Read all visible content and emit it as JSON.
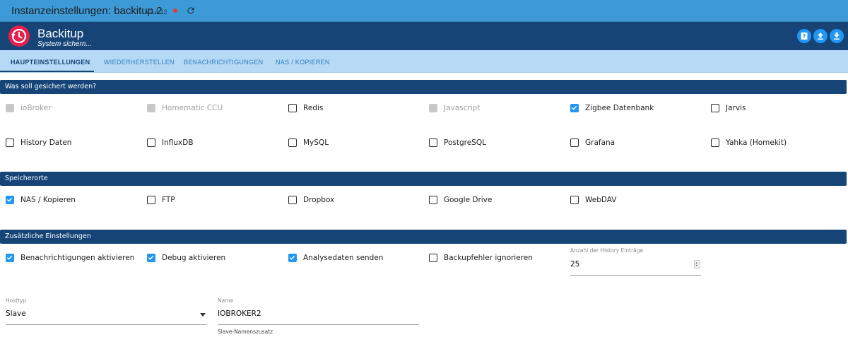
{
  "window": {
    "title": "Instanzeinstellungen: backitup.2",
    "version": "v2.4.12"
  },
  "app": {
    "name": "Backitup",
    "subtitle": "System sichern..."
  },
  "tabs": [
    {
      "label": "HAUPTEINSTELLUNGEN",
      "active": true
    },
    {
      "label": "WIEDERHERSTELLEN",
      "active": false
    },
    {
      "label": "BENACHRICHTIGUNGEN",
      "active": false
    },
    {
      "label": "NAS / KOPIEREN",
      "active": false
    }
  ],
  "sections": {
    "backup_what": "Was soll gesichert werden?",
    "storage": "Speicherorte",
    "extra": "Zusätzliche Einstellungen"
  },
  "backup_options": [
    {
      "label": "ioBroker",
      "checked": true,
      "disabled": true
    },
    {
      "label": "Homematic CCU",
      "checked": false,
      "disabled": true
    },
    {
      "label": "Redis",
      "checked": false,
      "disabled": false
    },
    {
      "label": "Javascript",
      "checked": false,
      "disabled": true
    },
    {
      "label": "Zigbee Datenbank",
      "checked": true,
      "disabled": false
    },
    {
      "label": "Jarvis",
      "checked": false,
      "disabled": false
    },
    {
      "label": "History Daten",
      "checked": false,
      "disabled": false
    },
    {
      "label": "InfluxDB",
      "checked": false,
      "disabled": false
    },
    {
      "label": "MySQL",
      "checked": false,
      "disabled": false
    },
    {
      "label": "PostgreSQL",
      "checked": false,
      "disabled": false
    },
    {
      "label": "Grafana",
      "checked": false,
      "disabled": false
    },
    {
      "label": "Yahka (Homekit)",
      "checked": false,
      "disabled": false
    }
  ],
  "storage_options": [
    {
      "label": "NAS / Kopieren",
      "checked": true
    },
    {
      "label": "FTP",
      "checked": false
    },
    {
      "label": "Dropbox",
      "checked": false
    },
    {
      "label": "Google Drive",
      "checked": false
    },
    {
      "label": "WebDAV",
      "checked": false
    }
  ],
  "extra_options": [
    {
      "label": "Benachrichtigungen aktivieren",
      "checked": true
    },
    {
      "label": "Debug aktivieren",
      "checked": true
    },
    {
      "label": "Analysedaten senden",
      "checked": true
    },
    {
      "label": "Backupfehler ignorieren",
      "checked": false
    }
  ],
  "history_entries": {
    "label": "Anzahl der History Einträge",
    "value": "25"
  },
  "hosttype": {
    "label": "Hosttyp",
    "value": "Slave"
  },
  "name_field": {
    "label": "Name",
    "value": "IOBROKER2",
    "helper": "Slave-Namenszusatz"
  },
  "colors": {
    "title_bar": "#3d9ad6",
    "header": "#164477",
    "tabs_bg": "#b6d9f5",
    "accent": "#2196f3",
    "logo": "#e4214c"
  }
}
